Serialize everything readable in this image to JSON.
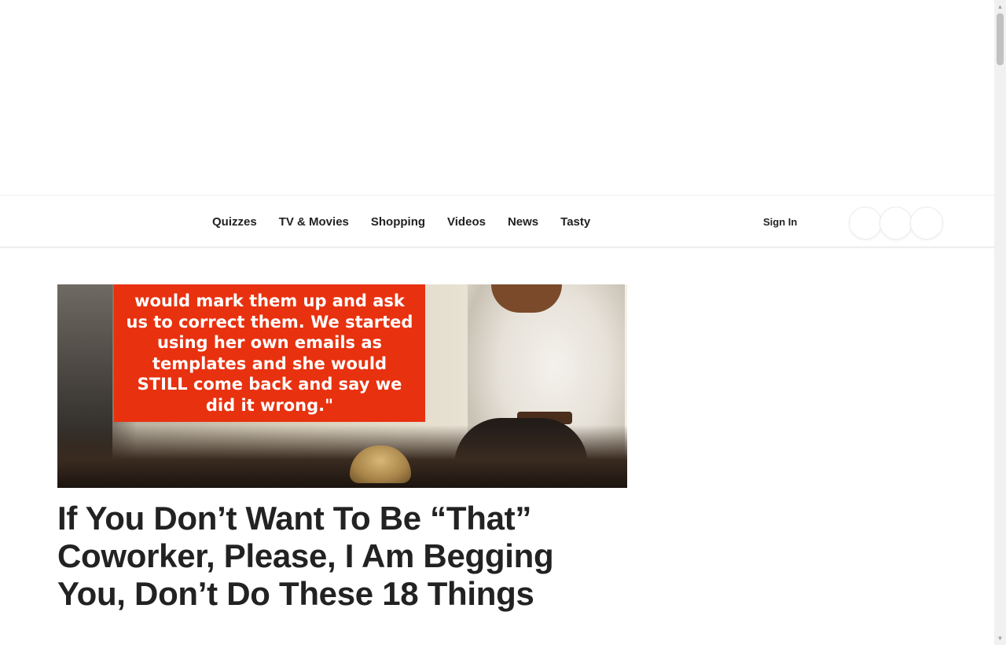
{
  "nav": {
    "items": [
      {
        "label": "Quizzes"
      },
      {
        "label": "TV & Movies"
      },
      {
        "label": "Shopping"
      },
      {
        "label": "Videos"
      },
      {
        "label": "News"
      },
      {
        "label": "Tasty"
      }
    ],
    "sign_in_label": "Sign In"
  },
  "article": {
    "hero_quote": "would mark them up and ask\nus to correct them. We started\nusing her own emails as\ntemplates and she would\nSTILL come back and say we\ndid it wrong.\"",
    "headline": "If You Don’t Want To Be “That” Coworker, Please, I Am Begging You, Don’t Do These 18 Things"
  },
  "colors": {
    "quote_box": "#e8310f",
    "text": "#222222"
  }
}
